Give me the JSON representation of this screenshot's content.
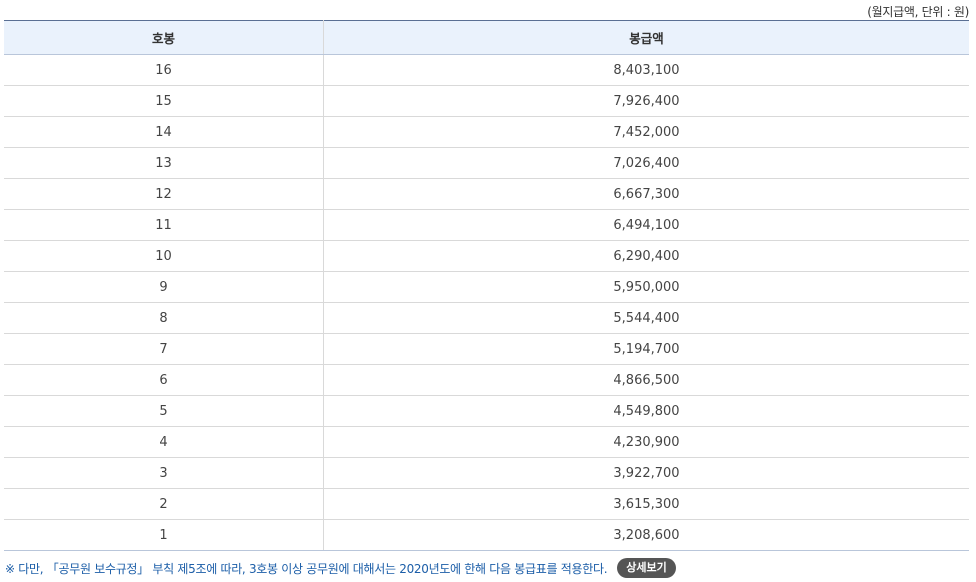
{
  "unit_note": "(월지급액, 단위 : 원)",
  "table": {
    "headers": {
      "step": "호봉",
      "amount": "봉급액"
    },
    "rows": [
      {
        "step": "16",
        "amount": "8,403,100"
      },
      {
        "step": "15",
        "amount": "7,926,400"
      },
      {
        "step": "14",
        "amount": "7,452,000"
      },
      {
        "step": "13",
        "amount": "7,026,400"
      },
      {
        "step": "12",
        "amount": "6,667,300"
      },
      {
        "step": "11",
        "amount": "6,494,100"
      },
      {
        "step": "10",
        "amount": "6,290,400"
      },
      {
        "step": "9",
        "amount": "5,950,000"
      },
      {
        "step": "8",
        "amount": "5,544,400"
      },
      {
        "step": "7",
        "amount": "5,194,700"
      },
      {
        "step": "6",
        "amount": "4,866,500"
      },
      {
        "step": "5",
        "amount": "4,549,800"
      },
      {
        "step": "4",
        "amount": "4,230,900"
      },
      {
        "step": "3",
        "amount": "3,922,700"
      },
      {
        "step": "2",
        "amount": "3,615,300"
      },
      {
        "step": "1",
        "amount": "3,208,600"
      }
    ]
  },
  "footnote": {
    "text": "※ 다만, 「공무원 보수규정」 부칙 제5조에 따라, 3호봉 이상 공무원에 대해서는 2020년도에 한해 다음 봉급표를 적용한다.",
    "button_label": "상세보기"
  },
  "colors": {
    "header_bg": "#eaf2fc",
    "footnote_text": "#1c5ea8",
    "button_bg": "#555555"
  }
}
